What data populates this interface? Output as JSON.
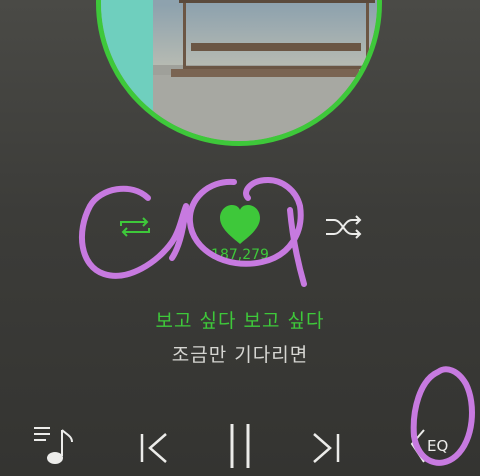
{
  "player": {
    "like_count": "187,279",
    "lyrics": {
      "current": "보고 싶다 보고 싶다",
      "next": "조금만 기다리면"
    },
    "eq_label": "EQ"
  },
  "icons": {
    "repeat": "repeat-icon",
    "like": "heart-icon",
    "shuffle": "shuffle-icon",
    "playlist": "playlist-music-icon",
    "previous": "previous-track-icon",
    "pause": "pause-icon",
    "next": "next-track-icon",
    "equalizer": "equalizer-icon"
  },
  "colors": {
    "accent": "#3ec83a",
    "background": "#3c3c39",
    "icon": "#ececea",
    "annotation": "#c77ae0"
  }
}
